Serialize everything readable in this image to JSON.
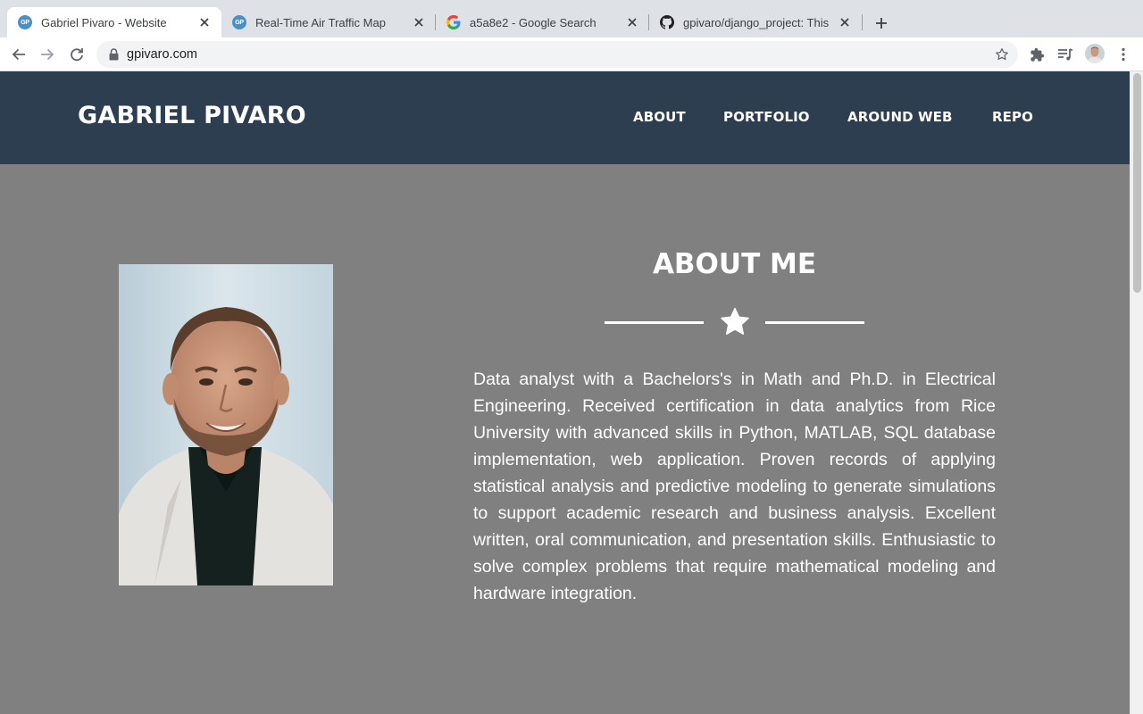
{
  "browser": {
    "tabs": [
      {
        "title": "Gabriel Pivaro - Website",
        "favicon": "gp-logo-icon",
        "active": true
      },
      {
        "title": "Real-Time Air Traffic Map",
        "favicon": "gp-logo-icon",
        "active": false
      },
      {
        "title": "a5a8e2 - Google Search",
        "favicon": "google-icon",
        "active": false
      },
      {
        "title": "gpivaro/django_project: This re",
        "favicon": "github-icon",
        "active": false
      }
    ],
    "favicon_text": "GP",
    "address_bar": {
      "url": "gpivaro.com"
    },
    "colors": {
      "tabstrip": "#dee1e6",
      "omnibox": "#f1f3f4"
    }
  },
  "site": {
    "brand": "GABRIEL PIVARO",
    "nav": [
      "ABOUT",
      "PORTFOLIO",
      "AROUND WEB",
      "REPO"
    ],
    "colors": {
      "header": "#2c3e50",
      "body": "#808080",
      "text": "#ffffff"
    }
  },
  "about": {
    "title": "ABOUT ME",
    "divider_icon": "star-icon",
    "text": "Data analyst with a Bachelors's in Math and Ph.D. in Electrical Engineering. Received certification in data analytics from Rice University with advanced skills in Python, MATLAB, SQL database implementation, web application. Proven records of applying statistical analysis and predictive modeling to generate simulations to support academic research and business analysis. Excellent written, oral communication, and presentation skills. Enthusiastic to solve complex problems that require mathematical modeling and hardware integration."
  }
}
